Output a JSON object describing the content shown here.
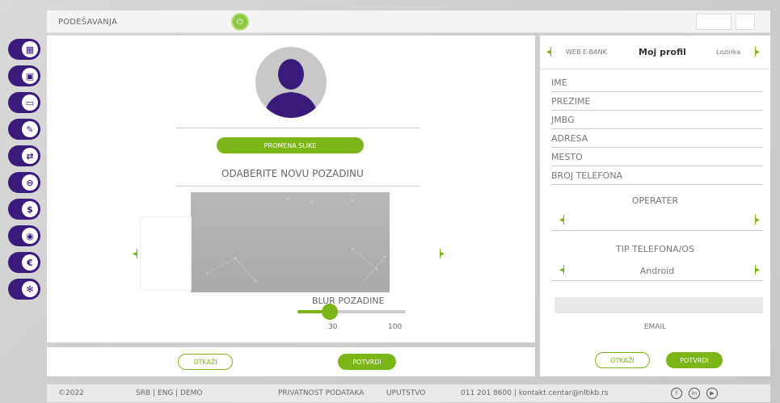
{
  "header": {
    "title": "PODEŠAVANJA"
  },
  "sidebar": {
    "items": [
      {
        "icon": "chart-icon",
        "glyph": "▦"
      },
      {
        "icon": "briefcase-icon",
        "glyph": "▣"
      },
      {
        "icon": "card-icon",
        "glyph": "▭"
      },
      {
        "icon": "pen-icon",
        "glyph": "✎"
      },
      {
        "icon": "exchange-icon",
        "glyph": "⇄"
      },
      {
        "icon": "minus-card-icon",
        "glyph": "⊖"
      },
      {
        "icon": "dollar-icon",
        "glyph": "$"
      },
      {
        "icon": "location-icon",
        "glyph": "◉"
      },
      {
        "icon": "euro-icon",
        "glyph": "€"
      },
      {
        "icon": "settings-icon",
        "glyph": "✻"
      }
    ]
  },
  "profile_image": {
    "change_button": "PROMENA SLIKE",
    "choose_background": "ODABERITE NOVU POZADINU",
    "blur_label": "BLUR POZADINE",
    "blur_value": "30",
    "blur_max": "100",
    "blur_level": 0.3
  },
  "left_actions": {
    "cancel": "OTKAŽI",
    "confirm": "POTVRDI"
  },
  "right_panel": {
    "tabs": {
      "left": "WEB E-BANK",
      "active": "Moj profil",
      "right": "Lozinka"
    },
    "fields": [
      "IME",
      "PREZIME",
      "JMBG",
      "ADRESA",
      "MESTO",
      "BROJ TELEFONA"
    ],
    "operater_label": "OPERATER",
    "operater_value": "",
    "phone_type_label": "TIP TELEFONA/OS",
    "phone_type_value": "Android",
    "email_label": "EMAIL",
    "cancel": "OTKAŽI",
    "confirm": "POTVRDI"
  },
  "footer": {
    "copyright": "©2022",
    "languages": "SRB  |  ENG  |  DEMO",
    "privacy": "PRIVATNOST PODATAKA",
    "guide": "UPUTSTVO",
    "contact": "011 201 8600  |  kontakt.centar@nlbkb.rs"
  },
  "colors": {
    "accent": "#7cb518",
    "sidebar": "#3a1a7a"
  }
}
